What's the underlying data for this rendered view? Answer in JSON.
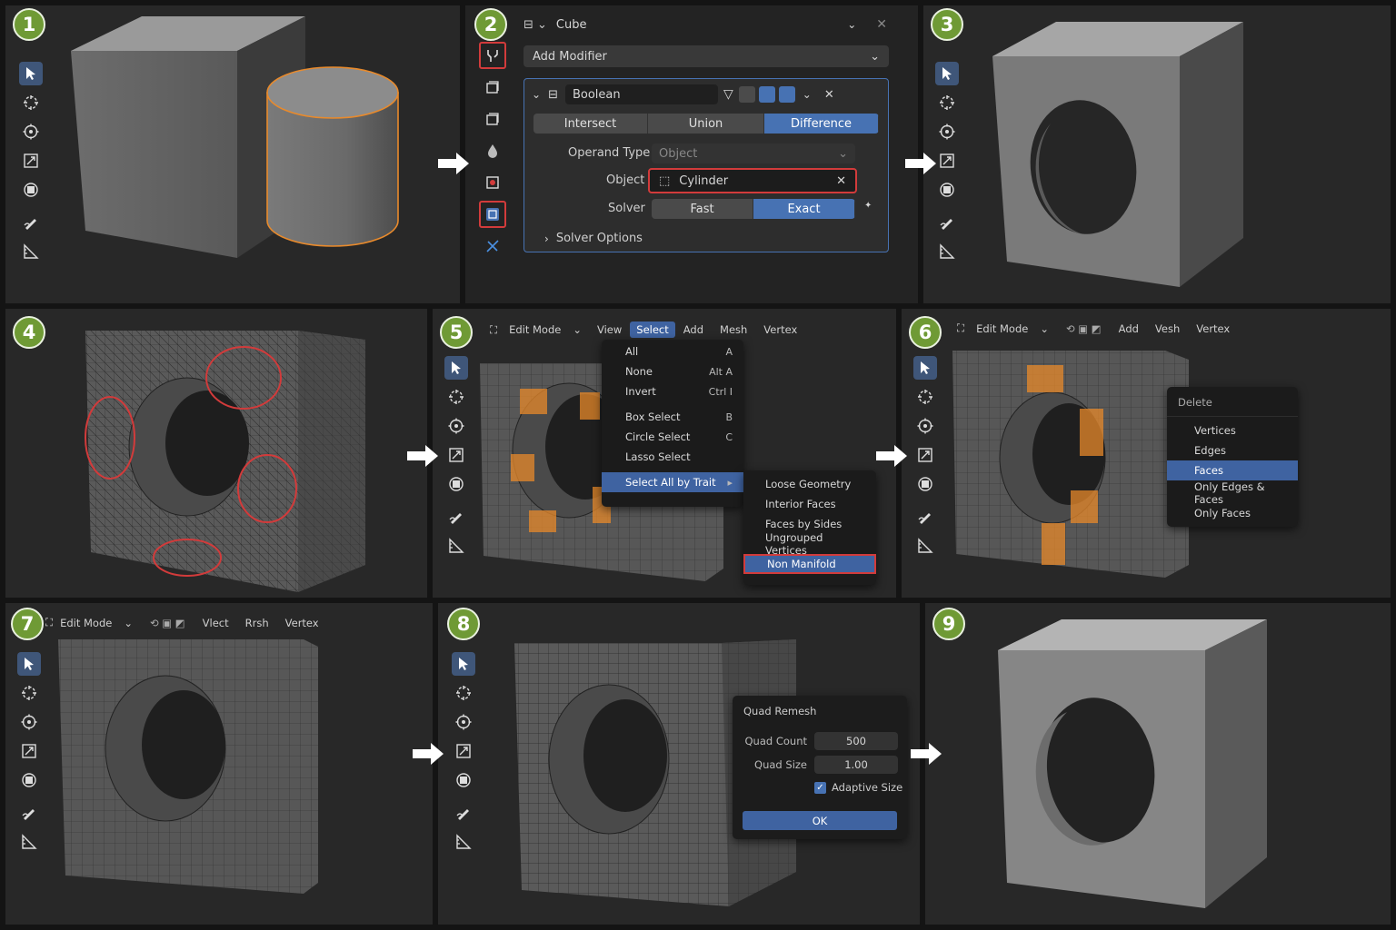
{
  "steps": [
    "1",
    "2",
    "3",
    "4",
    "5",
    "6",
    "7",
    "8",
    "9"
  ],
  "modifier_panel": {
    "object_name": "Cube",
    "add_modifier": "Add Modifier",
    "modifier_name": "Boolean",
    "operations": [
      "Intersect",
      "Union",
      "Difference"
    ],
    "active_operation": "Difference",
    "operand_type_label": "Operand Type",
    "operand_type_value": "Object",
    "object_label": "Object",
    "object_value": "Cylinder",
    "solver_label": "Solver",
    "solvers": [
      "Fast",
      "Exact"
    ],
    "active_solver": "Exact",
    "solver_options": "Solver Options"
  },
  "panel5": {
    "mode": "Edit Mode",
    "menu_bar": [
      "View",
      "Select",
      "Add",
      "Mesh",
      "Vertex"
    ],
    "active_menu": "Select",
    "select_menu": [
      {
        "label": "All",
        "shortcut": "A"
      },
      {
        "label": "None",
        "shortcut": "Alt A"
      },
      {
        "label": "Invert",
        "shortcut": "Ctrl I"
      },
      {
        "label": "Box Select",
        "shortcut": "B"
      },
      {
        "label": "Circle Select",
        "shortcut": "C"
      },
      {
        "label": "Lasso Select",
        "shortcut": ""
      },
      {
        "label": "Select All by Trait",
        "shortcut": "▸"
      }
    ],
    "trait_submenu": [
      "Loose Geometry",
      "Interior Faces",
      "Faces by Sides",
      "Ungrouped Vertices",
      "Non Manifold"
    ],
    "highlighted_trait": "Non Manifold"
  },
  "panel6": {
    "mode": "Edit Mode",
    "menu_bar": [
      "Add",
      "Vesh",
      "Vertex"
    ],
    "delete_title": "Delete",
    "delete_items": [
      "Vertices",
      "Edges",
      "Faces",
      "Only Edges & Faces",
      "Only Faces"
    ],
    "active_item": "Faces"
  },
  "panel7": {
    "mode": "Edit Mode",
    "menu_bar": [
      "Vlect",
      "Rrsh",
      "Vertex"
    ]
  },
  "panel8": {
    "dialog_title": "Quad Remesh",
    "quad_count_label": "Quad Count",
    "quad_count": "500",
    "quad_size_label": "Quad Size",
    "quad_size": "1.00",
    "adaptive_label": "Adaptive Size",
    "ok": "OK"
  },
  "colors": {
    "panel_bg": "#282828",
    "accent_blue": "#4772b3",
    "highlight_red": "#d23b3b",
    "selection_orange": "#e8892a",
    "step_green": "#6f9a35"
  }
}
